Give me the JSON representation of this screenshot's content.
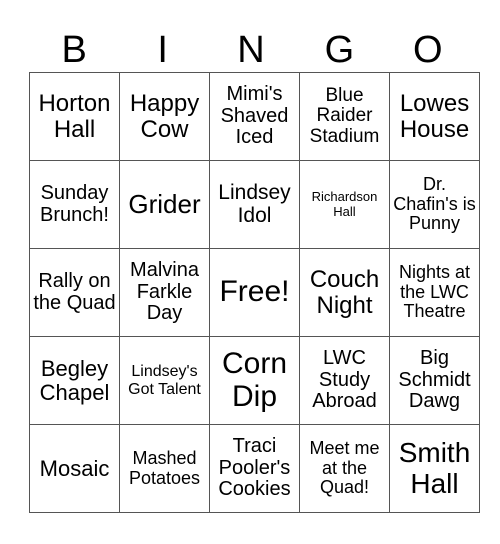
{
  "header": [
    "B",
    "I",
    "N",
    "G",
    "O"
  ],
  "cells": [
    [
      "Horton Hall",
      "Happy Cow",
      "Mimi's Shaved Iced",
      "Blue Raider Stadium",
      "Lowes House"
    ],
    [
      "Sunday Brunch!",
      "Grider",
      "Lindsey Idol",
      "Richardson Hall",
      "Dr. Chafin's is Punny"
    ],
    [
      "Rally on the Quad",
      "Malvina Farkle Day",
      "Free!",
      "Couch Night",
      "Nights at the LWC Theatre"
    ],
    [
      "Begley Chapel",
      "Lindsey's Got Talent",
      "Corn Dip",
      "LWC Study Abroad",
      "Big Schmidt Dawg"
    ],
    [
      "Mosaic",
      "Mashed Potatoes",
      "Traci Pooler's Cookies",
      "Meet me at the Quad!",
      "Smith Hall"
    ]
  ]
}
